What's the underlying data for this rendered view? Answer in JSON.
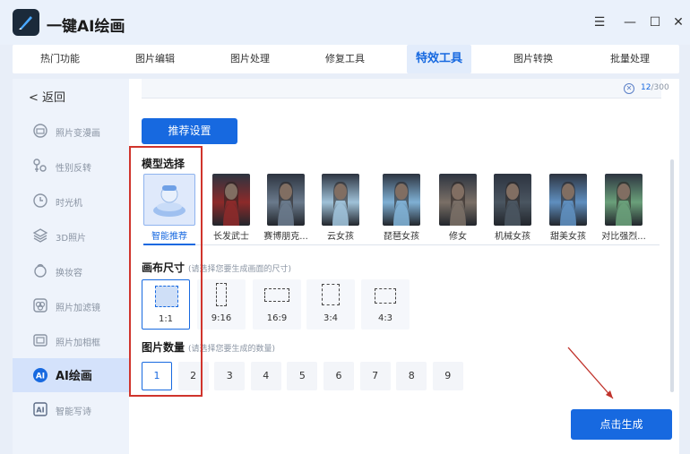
{
  "app": {
    "title": "一键AI绘画"
  },
  "window_controls": {
    "menu": "☰",
    "minimize": "—",
    "maximize": "☐",
    "close": "✕"
  },
  "tabs": [
    {
      "label": "热门功能"
    },
    {
      "label": "图片编辑"
    },
    {
      "label": "图片处理"
    },
    {
      "label": "修复工具"
    },
    {
      "label": "特效工具"
    },
    {
      "label": "图片转换"
    },
    {
      "label": "批量处理"
    }
  ],
  "active_tab": 4,
  "sidebar": {
    "back_label": "返回",
    "items": [
      {
        "label": "照片变漫画",
        "icon": "cartoon-icon"
      },
      {
        "label": "性别反转",
        "icon": "gender-icon"
      },
      {
        "label": "时光机",
        "icon": "clock-icon"
      },
      {
        "label": "3D照片",
        "icon": "layers-icon"
      },
      {
        "label": "换妆容",
        "icon": "makeup-icon"
      },
      {
        "label": "照片加滤镜",
        "icon": "filter-icon"
      },
      {
        "label": "照片加相框",
        "icon": "frame-icon"
      },
      {
        "label": "AI绘画",
        "icon": "ai-icon"
      },
      {
        "label": "智能写诗",
        "icon": "ai-poem-icon"
      }
    ],
    "active_index": 7
  },
  "prompt": {
    "count_current": "12",
    "count_max": "/300"
  },
  "recommend_button": "推荐设置",
  "model_section": {
    "title": "模型选择",
    "models": [
      {
        "name": "智能推荐",
        "color": "#b9d2f4"
      },
      {
        "name": "长发武士",
        "color": "#8c2a2a"
      },
      {
        "name": "赛博朋克...",
        "color": "#6a7a8c"
      },
      {
        "name": "云女孩",
        "color": "#9fc1d8"
      },
      {
        "name": "琵琶女孩",
        "color": "#7fb0d4"
      },
      {
        "name": "修女",
        "color": "#7a6f66"
      },
      {
        "name": "机械女孩",
        "color": "#4a5560"
      },
      {
        "name": "甜美女孩",
        "color": "#5f8fbf"
      },
      {
        "name": "对比强烈...",
        "color": "#6aa07a"
      }
    ],
    "active_index": 0
  },
  "canvas_section": {
    "title": "画布尺寸",
    "hint": "(请选择您要生成画面的尺寸)",
    "ratios": [
      "1:1",
      "9:16",
      "16:9",
      "3:4",
      "4:3"
    ],
    "active_index": 0
  },
  "count_section": {
    "title": "图片数量",
    "hint": "(请选择您要生成的数量)",
    "numbers": [
      "1",
      "2",
      "3",
      "4",
      "5",
      "6",
      "7",
      "8",
      "9"
    ],
    "active_index": 0
  },
  "generate_button": "点击生成",
  "colors": {
    "accent": "#1769e0",
    "highlight": "#d0342c"
  }
}
